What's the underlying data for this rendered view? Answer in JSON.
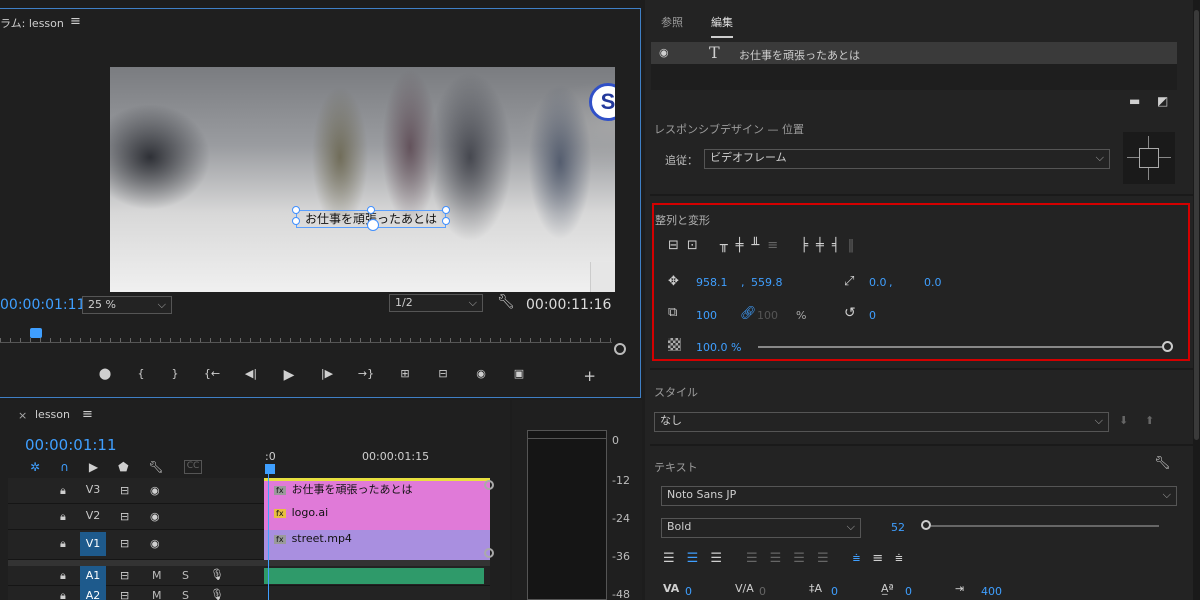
{
  "monitor": {
    "title": "ラム: lesson",
    "menu_icon": "hamburger-icon",
    "video_text": "お仕事を頑張ったあとは",
    "sticker_letter": "S",
    "playhead_time": "00:00:01:11",
    "zoom": "25 %",
    "resolution": "1/2",
    "duration": "00:00:11:16",
    "transport_icons": [
      "marker-icon",
      "mark-in-icon",
      "mark-out-icon",
      "go-to-in-icon",
      "step-back-icon",
      "play-icon",
      "step-forward-icon",
      "go-to-out-icon",
      "lift-icon",
      "extract-icon",
      "camera-icon",
      "comparison-icon",
      "add-icon"
    ],
    "transport_glyphs": [
      "⬤",
      "{",
      "}",
      "{←",
      "◀|",
      "▶",
      "|▶",
      "→}",
      "⊞",
      "⊟",
      "◉",
      "▣",
      "+"
    ]
  },
  "timeline": {
    "title": "lesson",
    "timecode": "00:00:01:11",
    "ruler_start": ":0",
    "ruler_mark": "00:00:01:15",
    "tracks": [
      {
        "name": "V3",
        "clip": "お仕事を頑張ったあとは",
        "color": "#e07ad8",
        "fx": "fx"
      },
      {
        "name": "V2",
        "clip": "logo.ai",
        "color": "#e07ad8",
        "fx": "fx"
      },
      {
        "name": "V1",
        "clip": "street.mp4",
        "color": "#a98fe0",
        "fx": "fx"
      },
      {
        "name": "A1",
        "clip": "",
        "color": "#2f9a6a",
        "fx": ""
      },
      {
        "name": "A2",
        "clip": "",
        "color": "",
        "fx": ""
      }
    ],
    "audio_toggles": [
      "M",
      "S"
    ],
    "meter_labels": [
      "0",
      "-12",
      "-24",
      "-36",
      "-48"
    ]
  },
  "panel": {
    "tabs": [
      "参照",
      "編集"
    ],
    "layer_name": "お仕事を頑張ったあとは",
    "responsive_title": "レスポンシブデザイン — 位置",
    "follow_label": "追従：",
    "follow_value": "ビデオフレーム",
    "align_title": "整列と変形",
    "position_x": "958.1",
    "position_y": "559.8",
    "anchor_x": "0.0",
    "anchor_y": "0.0",
    "scale": "100",
    "scale_locked": "100",
    "scale_unit": "%",
    "rotation": "0",
    "opacity": "100.0 %",
    "style_title": "スタイル",
    "style_value": "なし",
    "text_title": "テキスト",
    "font_family": "Noto Sans JP",
    "font_style": "Bold",
    "font_size": "52",
    "kerning": "0",
    "tracking": "0",
    "leading": "0",
    "baseline": "0",
    "tsume": "400",
    "accent_color": "#3f9fff",
    "highlight_color": "#d40000"
  }
}
